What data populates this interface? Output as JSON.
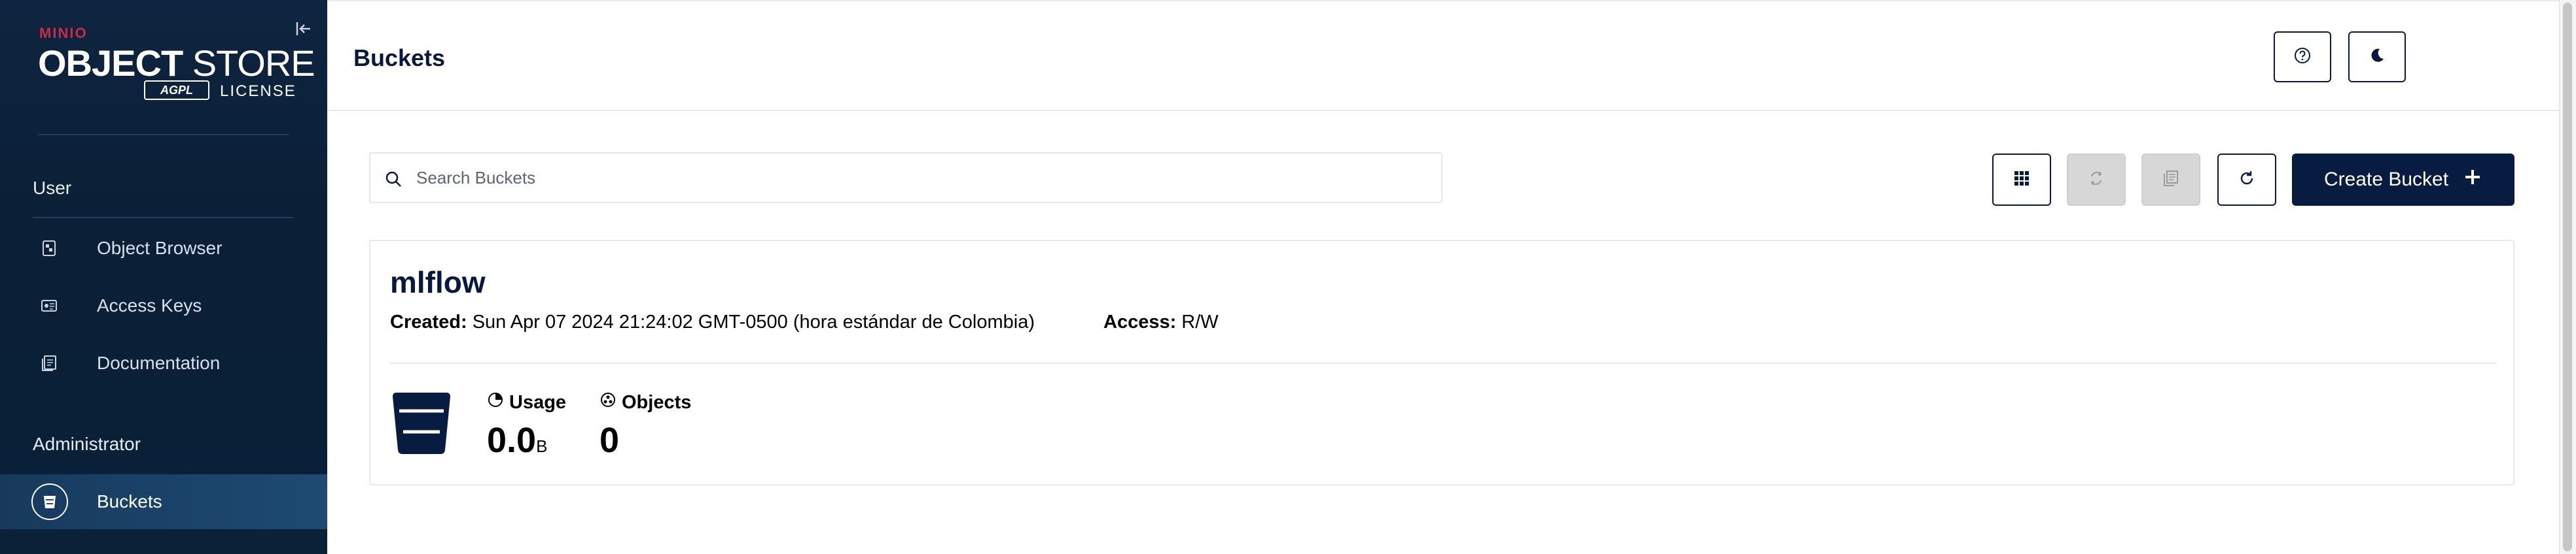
{
  "sidebar": {
    "logo": {
      "brand": "MINIO",
      "product_bold": "OBJECT",
      "product_light": " STORE",
      "agpl": "AGPL",
      "license": "LICENSE"
    },
    "user_section": "User",
    "user_items": [
      {
        "label": "Object Browser",
        "icon": "object-browser-icon"
      },
      {
        "label": "Access Keys",
        "icon": "access-keys-icon"
      },
      {
        "label": "Documentation",
        "icon": "documentation-icon"
      }
    ],
    "admin_section": "Administrator",
    "admin_items": [
      {
        "label": "Buckets",
        "icon": "bucket-icon",
        "active": true
      }
    ]
  },
  "header": {
    "title": "Buckets"
  },
  "toolbar": {
    "search_placeholder": "Search Buckets",
    "create_label": "Create Bucket"
  },
  "buckets": [
    {
      "name": "mlflow",
      "created_label": "Created:",
      "created_value": " Sun Apr 07 2024 21:24:02 GMT-0500 (hora estándar de Colombia)",
      "access_label": "Access:",
      "access_value": " R/W",
      "usage_label": "Usage",
      "usage_value": "0.0",
      "usage_unit": "B",
      "objects_label": "Objects",
      "objects_value": "0"
    }
  ],
  "colors": {
    "sidebar_bg": "#0e2440",
    "accent_dark": "#081c42",
    "brand_red": "#c72c48"
  }
}
